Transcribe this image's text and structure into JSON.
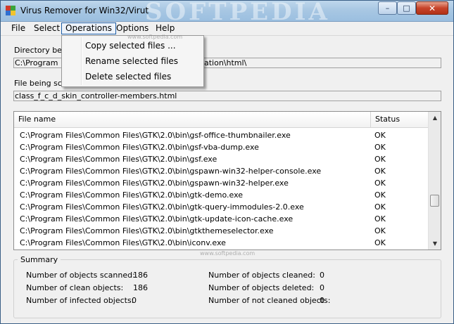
{
  "window": {
    "title": "Virus Remover for Win32/Virut",
    "watermark": "SOFTPEDIA",
    "controls": {
      "minimize": "–",
      "maximize": "□",
      "close": "✕"
    }
  },
  "menu": {
    "items": [
      "File",
      "Select",
      "Operations",
      "Options",
      "Help"
    ],
    "active": "Operations",
    "dropdown": [
      "Copy selected files ...",
      "Rename selected files",
      "Delete selected files"
    ]
  },
  "directory": {
    "label": "Directory bein",
    "value_left": "C:\\Program Fi",
    "value_right": "ation\\html\\"
  },
  "file_scan": {
    "label": "File being scan",
    "value": "class_f_c_d_skin_controller-members.html"
  },
  "list": {
    "headers": {
      "name": "File name",
      "status": "Status"
    },
    "rows": [
      {
        "name": "C:\\Program Files\\Common Files\\GTK\\2.0\\bin\\gsf-office-thumbnailer.exe",
        "status": "OK"
      },
      {
        "name": "C:\\Program Files\\Common Files\\GTK\\2.0\\bin\\gsf-vba-dump.exe",
        "status": "OK"
      },
      {
        "name": "C:\\Program Files\\Common Files\\GTK\\2.0\\bin\\gsf.exe",
        "status": "OK"
      },
      {
        "name": "C:\\Program Files\\Common Files\\GTK\\2.0\\bin\\gspawn-win32-helper-console.exe",
        "status": "OK"
      },
      {
        "name": "C:\\Program Files\\Common Files\\GTK\\2.0\\bin\\gspawn-win32-helper.exe",
        "status": "OK"
      },
      {
        "name": "C:\\Program Files\\Common Files\\GTK\\2.0\\bin\\gtk-demo.exe",
        "status": "OK"
      },
      {
        "name": "C:\\Program Files\\Common Files\\GTK\\2.0\\bin\\gtk-query-immodules-2.0.exe",
        "status": "OK"
      },
      {
        "name": "C:\\Program Files\\Common Files\\GTK\\2.0\\bin\\gtk-update-icon-cache.exe",
        "status": "OK"
      },
      {
        "name": "C:\\Program Files\\Common Files\\GTK\\2.0\\bin\\gtkthemeselector.exe",
        "status": "OK"
      },
      {
        "name": "C:\\Program Files\\Common Files\\GTK\\2.0\\bin\\iconv.exe",
        "status": "OK"
      }
    ]
  },
  "summary": {
    "title": "Summary",
    "left": [
      {
        "label": "Number of objects scanned:",
        "value": "186"
      },
      {
        "label": "Number of clean objects:",
        "value": "186"
      },
      {
        "label": "Number of infected objects:",
        "value": "0"
      }
    ],
    "right": [
      {
        "label": "Number of objects cleaned:",
        "value": "0"
      },
      {
        "label": "Number of objects deleted:",
        "value": "0"
      },
      {
        "label": "Number of not cleaned objects:",
        "value": "0"
      }
    ]
  },
  "watermark_small": "www.softpedia.com",
  "watermark_small2": "www.softpedia.com",
  "colors": {
    "titlebar": "#a8c7e3",
    "close_button": "#c7432a",
    "menu_highlight": "#1d5ea8"
  }
}
